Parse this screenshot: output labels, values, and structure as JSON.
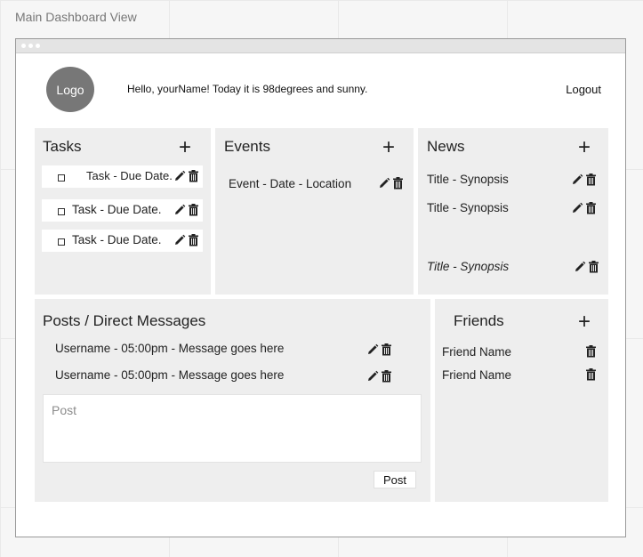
{
  "canvas": {
    "title": "Main Dashboard View"
  },
  "header": {
    "logo_label": "Logo",
    "greeting": "Hello, yourName!  Today it is 98degrees and sunny.",
    "logout_label": "Logout"
  },
  "tasks": {
    "title": "Tasks",
    "add_label": "+",
    "items": [
      {
        "label": "Task - Due Date."
      },
      {
        "label": "Task - Due Date."
      },
      {
        "label": "Task - Due Date."
      }
    ]
  },
  "events": {
    "title": "Events",
    "add_label": "+",
    "items": [
      {
        "label": "Event - Date - Location"
      }
    ]
  },
  "news": {
    "title": "News",
    "add_label": "+",
    "items": [
      {
        "label": "Title - Synopsis"
      },
      {
        "label": "Title - Synopsis"
      },
      {
        "label": "Title - Synopsis"
      }
    ]
  },
  "posts": {
    "title": "Posts / Direct Messages",
    "messages": [
      {
        "label": "Username - 05:00pm - Message goes here"
      },
      {
        "label": "Username - 05:00pm - Message goes here"
      }
    ],
    "input_placeholder": "Post",
    "submit_label": "Post"
  },
  "friends": {
    "title": "Friends",
    "add_label": "+",
    "items": [
      {
        "name": "Friend Name"
      },
      {
        "name": "Friend Name"
      }
    ]
  },
  "icons": {
    "edit": "pencil-icon",
    "delete": "trash-icon",
    "add": "plus-icon"
  },
  "colors": {
    "logo_bg": "#777777",
    "panel_bg": "#eeeeee",
    "window_border": "#9a9a9a"
  }
}
